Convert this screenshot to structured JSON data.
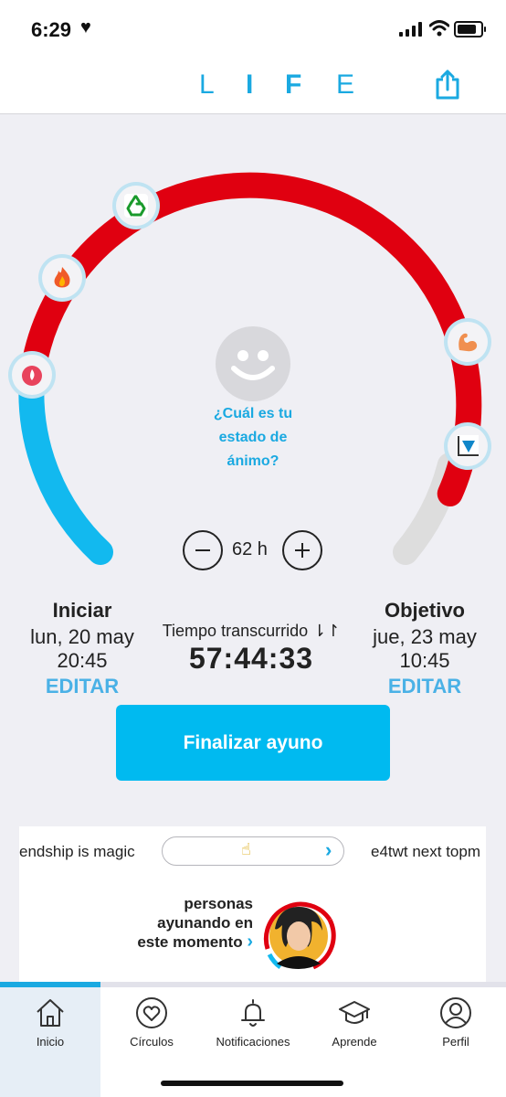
{
  "status_bar": {
    "time": "6:29",
    "heart_icon": "heart-icon",
    "signal_icon": "signal-icon",
    "wifi_icon": "wifi-icon",
    "battery_icon": "battery-icon"
  },
  "header": {
    "logo_letters": [
      "L",
      "I",
      "F",
      "E"
    ],
    "share_icon": "share-icon"
  },
  "gauge": {
    "elapsed_fraction_red": "red arc from fat-burning markers",
    "colors": {
      "blue": "#12b9ef",
      "red": "#e00010",
      "gray": "#dddddd"
    },
    "markers": [
      {
        "icon": "drop-icon",
        "name": "marker-blood-sugar"
      },
      {
        "icon": "fire-icon",
        "name": "marker-fat-burn"
      },
      {
        "icon": "recycle-icon",
        "name": "marker-autophagy"
      },
      {
        "icon": "muscle-icon",
        "name": "marker-growth-hormone"
      },
      {
        "icon": "chart-icon",
        "name": "marker-insulin"
      }
    ]
  },
  "mood": {
    "prompt": "¿Cuál es tu estado de ánimo?",
    "icon": "smiley-icon"
  },
  "duration": {
    "value": "62 h",
    "minus_icon": "minus-icon",
    "plus_icon": "plus-icon"
  },
  "start": {
    "title": "Iniciar",
    "date": "lun, 20 may",
    "time": "20:45",
    "edit": "EDITAR"
  },
  "goal": {
    "title": "Objetivo",
    "date": "jue, 23 may",
    "time": "10:45",
    "edit": "EDITAR"
  },
  "elapsed": {
    "label": "Tiempo transcurrido ⇂↾",
    "value": "57:44:33"
  },
  "finish_button": "Finalizar ayuno",
  "community": {
    "ticker_left": "endship is magic",
    "ticker_right": "e4twt next topm",
    "pill_icon": "☝",
    "people_text": "personas ayunando en este momento",
    "chevron": "›"
  },
  "tabs": [
    {
      "label": "Inicio",
      "icon": "home-icon",
      "active": true
    },
    {
      "label": "Círculos",
      "icon": "heart-circle-icon",
      "active": false
    },
    {
      "label": "Notificaciones",
      "icon": "bell-icon",
      "active": false
    },
    {
      "label": "Aprende",
      "icon": "graduation-cap-icon",
      "active": false
    },
    {
      "label": "Perfil",
      "icon": "profile-icon",
      "active": false
    }
  ]
}
